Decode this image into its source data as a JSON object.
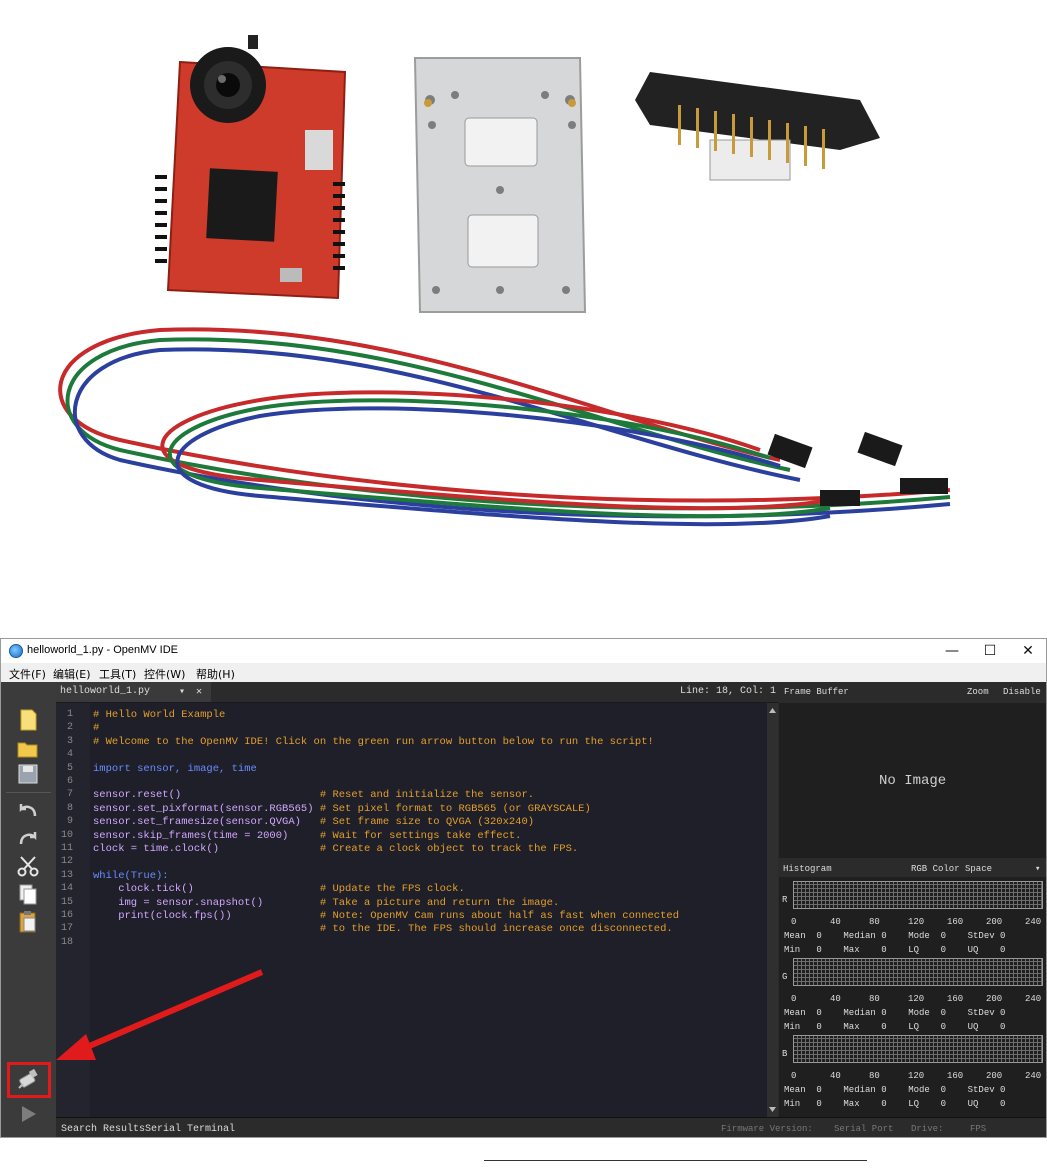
{
  "window": {
    "title": "helloworld_1.py - OpenMV IDE",
    "controls": {
      "minimize": "—",
      "maximize": "☐",
      "close": "✕"
    }
  },
  "menu": [
    "文件(F)",
    "编辑(E)",
    "工具(T)",
    "控件(W)",
    "帮助(H)"
  ],
  "tab": {
    "filename": "helloworld_1.py",
    "dropdown": "▾",
    "close": "✕"
  },
  "cursor_position": "Line: 18, Col: 1",
  "code_lines": [
    {
      "n": "1",
      "t": "# Hello World Example"
    },
    {
      "n": "2",
      "t": "#"
    },
    {
      "n": "3",
      "t": "# Welcome to the OpenMV IDE! Click on the green run arrow button below to run the script!"
    },
    {
      "n": "4",
      "t": ""
    },
    {
      "n": "5",
      "t": "import sensor, image, time"
    },
    {
      "n": "6",
      "t": ""
    },
    {
      "n": "7",
      "t": "sensor.reset()                      # Reset and initialize the sensor."
    },
    {
      "n": "8",
      "t": "sensor.set_pixformat(sensor.RGB565) # Set pixel format to RGB565 (or GRAYSCALE)"
    },
    {
      "n": "9",
      "t": "sensor.set_framesize(sensor.QVGA)   # Set frame size to QVGA (320x240)"
    },
    {
      "n": "10",
      "t": "sensor.skip_frames(time = 2000)     # Wait for settings take effect."
    },
    {
      "n": "11",
      "t": "clock = time.clock()                # Create a clock object to track the FPS."
    },
    {
      "n": "12",
      "t": ""
    },
    {
      "n": "13",
      "t": "while(True):"
    },
    {
      "n": "14",
      "t": "    clock.tick()                    # Update the FPS clock."
    },
    {
      "n": "15",
      "t": "    img = sensor.snapshot()         # Take a picture and return the image."
    },
    {
      "n": "16",
      "t": "    print(clock.fps())              # Note: OpenMV Cam runs about half as fast when connected"
    },
    {
      "n": "17",
      "t": "                                    # to the IDE. The FPS should increase once disconnected."
    },
    {
      "n": "18",
      "t": ""
    }
  ],
  "frame_buffer": {
    "label": "Frame Buffer",
    "zoom": "Zoom",
    "disable": "Disable",
    "placeholder": "No Image"
  },
  "histogram": {
    "label": "Histogram",
    "color_space": "RGB Color Space",
    "channels": [
      "R",
      "G",
      "B"
    ],
    "axis_ticks": [
      "0",
      "40",
      "80",
      "120",
      "160",
      "200",
      "240"
    ],
    "stats_row1": "Mean  0    Median 0    Mode  0    StDev 0",
    "stats_row2": "Min   0    Max    0    LQ    0    UQ    0"
  },
  "status_tabs": {
    "search": "Search Results",
    "serial": "Serial Terminal"
  },
  "status_info": {
    "firmware": "Firmware Version:",
    "port": "Serial Port",
    "drive": "Drive:",
    "fps": "FPS"
  },
  "annotation": {
    "arrow_color": "#e11b1b",
    "highlight_target": "connect-button"
  }
}
